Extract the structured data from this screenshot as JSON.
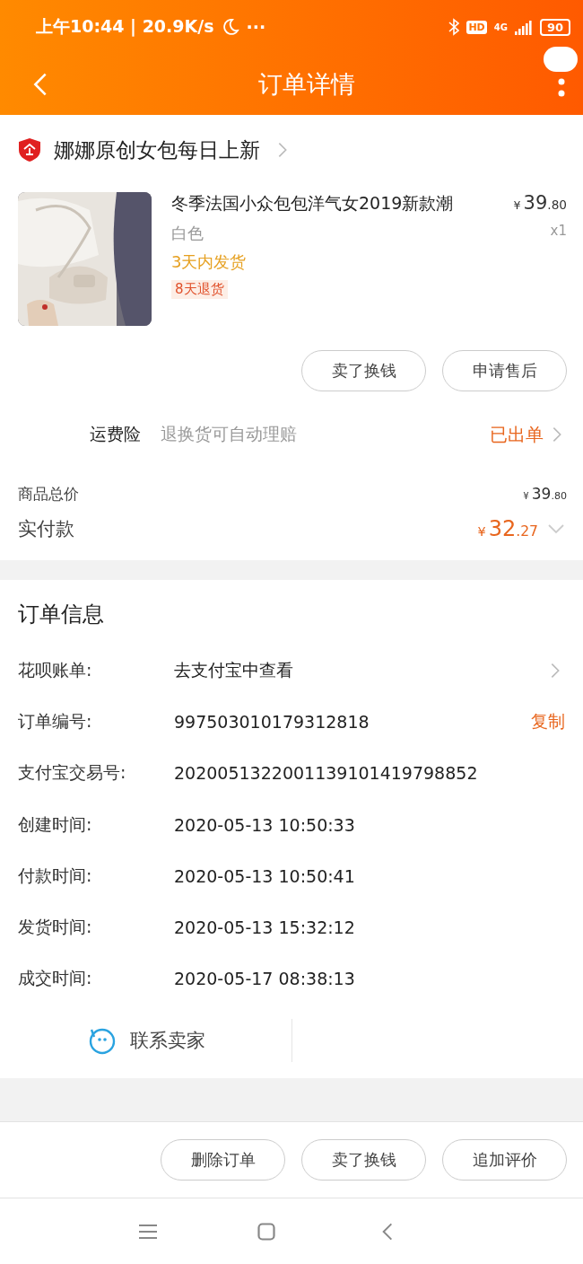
{
  "status_bar": {
    "time": "上午10:44 | 20.9K/s",
    "more": "···",
    "hd": "HD",
    "network": "4G",
    "battery": "90"
  },
  "nav": {
    "title": "订单详情"
  },
  "shop": {
    "name": "娜娜原创女包每日上新"
  },
  "product": {
    "kind": "picture",
    "title": "冬季法国小众包包洋气女2019新款潮",
    "variant": "白色",
    "shipping": "3天内发货",
    "tag": "8天退货",
    "price": {
      "currency": "¥",
      "integer": "39",
      "decimal": ".80"
    },
    "quantity": "x1"
  },
  "product_buttons": [
    "卖了换钱",
    "申请售后"
  ],
  "insurance": {
    "label": "运费险",
    "description": "退换货可自动理赔",
    "status": "已出单"
  },
  "totals": {
    "goods_label": "商品总价",
    "goods_price": {
      "currency": "¥",
      "integer": "39",
      "decimal": ".80"
    },
    "paid_label": "实付款",
    "paid_price": {
      "currency": "¥",
      "integer": "32",
      "decimal": ".27"
    },
    "expanded": false
  },
  "order_info": {
    "title": "订单信息",
    "rows": [
      {
        "kind": "link",
        "label": "花呗账单:",
        "value": "去支付宝中查看"
      },
      {
        "kind": "copy",
        "label": "订单编号:",
        "value": "997503010179312818",
        "action": "复制"
      },
      {
        "kind": "plain",
        "label": "支付宝交易号:",
        "value": "2020051322001139101419798852"
      },
      {
        "kind": "plain",
        "label": "创建时间:",
        "value": "2020-05-13 10:50:33"
      },
      {
        "kind": "plain",
        "label": "付款时间:",
        "value": "2020-05-13 10:50:41"
      },
      {
        "kind": "plain",
        "label": "发货时间:",
        "value": "2020-05-13 15:32:12"
      },
      {
        "kind": "plain",
        "label": "成交时间:",
        "value": "2020-05-17 08:38:13"
      }
    ]
  },
  "contact": {
    "label": "联系卖家"
  },
  "bottom_buttons": [
    "删除订单",
    "卖了换钱",
    "追加评价"
  ]
}
